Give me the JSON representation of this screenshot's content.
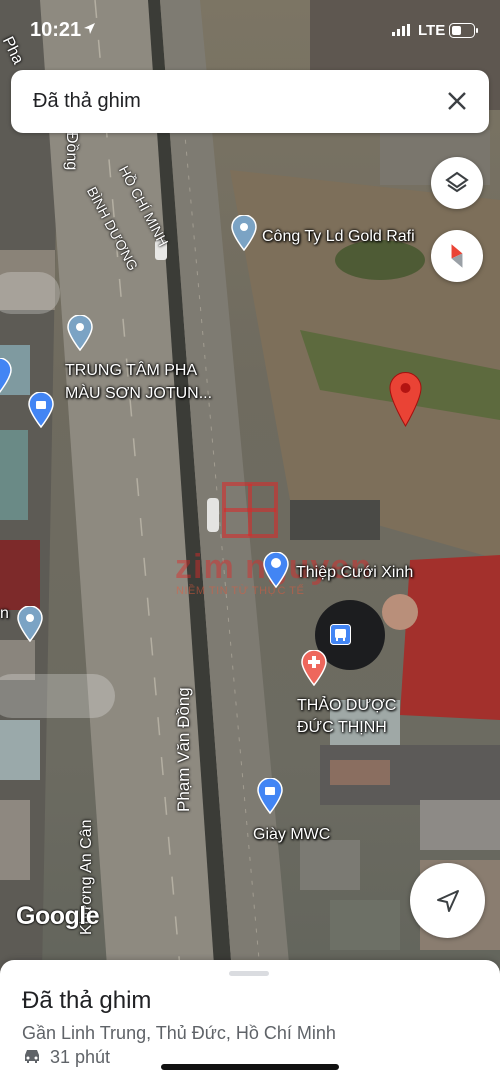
{
  "status_bar": {
    "time": "10:21",
    "network": "LTE"
  },
  "search": {
    "text": "Đã thả ghim"
  },
  "map": {
    "roads": {
      "pham_top": "Pha",
      "dong": "Đồng",
      "ho_chi_minh": "Hồ Chí Minh",
      "binh_duong": "Bình Dương",
      "pham_van_dong": "Phạm Văn Đồng",
      "khuong_can": "Khương An Cân"
    },
    "pois": {
      "gold_rafi": "Công Ty Ld Gold Rafi",
      "jotun_line1": "TRUNG TÂM PHA",
      "jotun_line2": "MÀU SƠN JOTUN...",
      "thiep_cuoi": "Thiệp Cưới Xinh",
      "thao_duoc_line1": "THẢO DƯỢC",
      "thao_duoc_line2": "ĐỨC THỊNH",
      "giay_mwc": "Giày MWC",
      "left_fragment": "n"
    },
    "watermark": {
      "brand": "zim nguyen",
      "tagline": "NIỀM TIN TỪ THỰC TẾ"
    },
    "google_logo": "Google"
  },
  "sheet": {
    "title": "Đã thả ghim",
    "subtitle": "Gần Linh Trung, Thủ Đức, Hồ Chí Minh",
    "travel_time": "31 phút"
  }
}
